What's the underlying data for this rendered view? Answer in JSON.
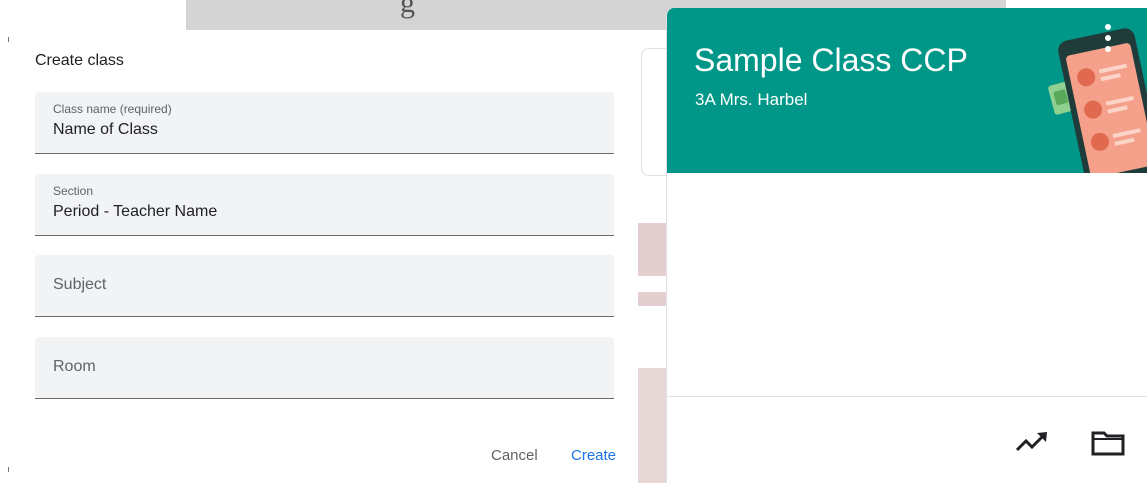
{
  "dialog": {
    "title": "Create class",
    "fields": [
      {
        "label": "Class name (required)",
        "value": "Name of Class"
      },
      {
        "label": "Section",
        "value": "Period - Teacher Name"
      },
      {
        "placeholder": "Subject"
      },
      {
        "placeholder": "Room"
      }
    ],
    "cancel_label": "Cancel",
    "create_label": "Create"
  },
  "card": {
    "title": "Sample Class CCP",
    "section": "3A Mrs. Harbel",
    "header_color": "#009688",
    "icons": [
      "trending-up-icon",
      "folder-icon",
      "more-vert-icon"
    ]
  },
  "background": {
    "strip_text": "g"
  }
}
